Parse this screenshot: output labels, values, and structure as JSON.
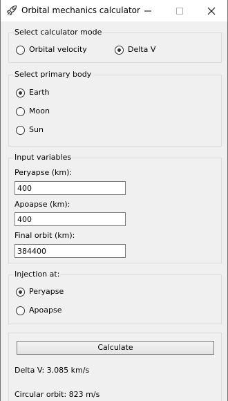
{
  "window": {
    "title": "Orbital mechanics calculator",
    "icons": {
      "app": "rocket-icon",
      "minimize": "minimize-icon",
      "maximize": "maximize-icon",
      "close": "close-icon"
    }
  },
  "mode_group": {
    "label": "Select calculator mode",
    "options": [
      {
        "label": "Orbital velocity",
        "selected": false
      },
      {
        "label": "Delta V",
        "selected": true
      }
    ]
  },
  "body_group": {
    "label": "Select primary body",
    "options": [
      {
        "label": "Earth",
        "selected": true
      },
      {
        "label": "Moon",
        "selected": false
      },
      {
        "label": "Sun",
        "selected": false
      }
    ]
  },
  "inputs_group": {
    "label": "Input variables",
    "fields": [
      {
        "label": "Peryapse (km):",
        "value": "400"
      },
      {
        "label": "Apoapse (km):",
        "value": "400"
      },
      {
        "label": "Final orbit (km):",
        "value": "384400"
      }
    ]
  },
  "injection_group": {
    "label": "Injection at:",
    "options": [
      {
        "label": "Peryapse",
        "selected": true
      },
      {
        "label": "Apoapse",
        "selected": false
      }
    ]
  },
  "results": {
    "calculate_label": "Calculate",
    "delta_v": "Delta V: 3.085 km/s",
    "circular_orbit": "Circular orbit: 823 m/s"
  }
}
